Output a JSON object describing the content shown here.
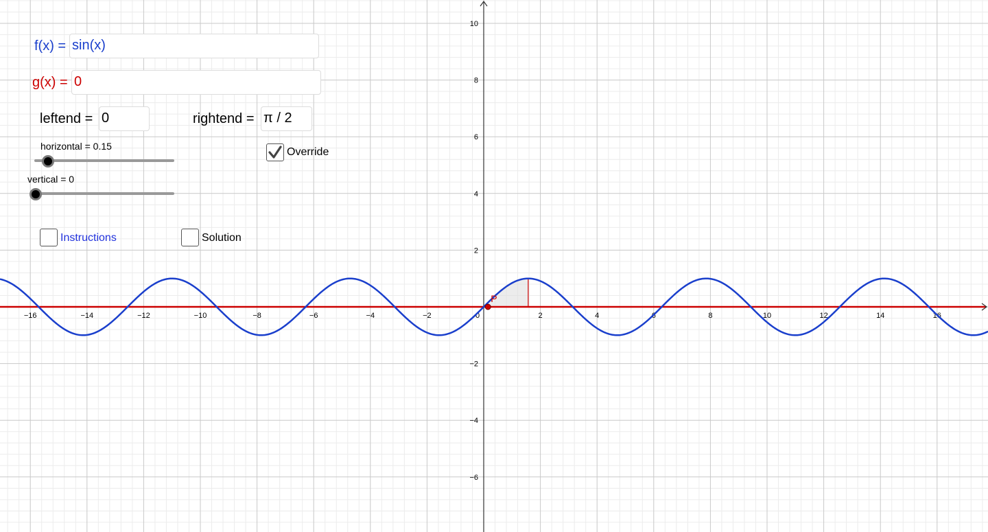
{
  "inputs": {
    "f": {
      "label": "f(x) =",
      "value": "sin(x)",
      "color": "#1a3fcc"
    },
    "g": {
      "label": "g(x) =",
      "value": "0",
      "color": "#cc0000"
    },
    "leftend": {
      "label": "leftend =",
      "value": "0"
    },
    "rightend": {
      "label": "rightend =",
      "value": "π / 2"
    }
  },
  "sliders": {
    "horizontal": {
      "label": "horizontal = 0.15",
      "value": 0.15
    },
    "vertical": {
      "label": "vertical = 0",
      "value": 0
    }
  },
  "checkboxes": {
    "override": {
      "label": "Override",
      "checked": true
    },
    "instructions": {
      "label": "Instructions",
      "checked": false,
      "color": "#2233dd"
    },
    "solution": {
      "label": "Solution",
      "checked": false
    }
  },
  "graph": {
    "x_ticks": [
      "−16",
      "−14",
      "−12",
      "−10",
      "−8",
      "−6",
      "−4",
      "−2",
      "0",
      "2",
      "4",
      "6",
      "8",
      "10",
      "12",
      "14",
      "16"
    ],
    "y_ticks": [
      "10",
      "8",
      "6",
      "4",
      "2",
      "−2",
      "−4",
      "−6"
    ],
    "point_label": "P",
    "curve_color": "#1a3fcc",
    "line_color": "#cc0000",
    "point_color": "#cc0000"
  }
}
